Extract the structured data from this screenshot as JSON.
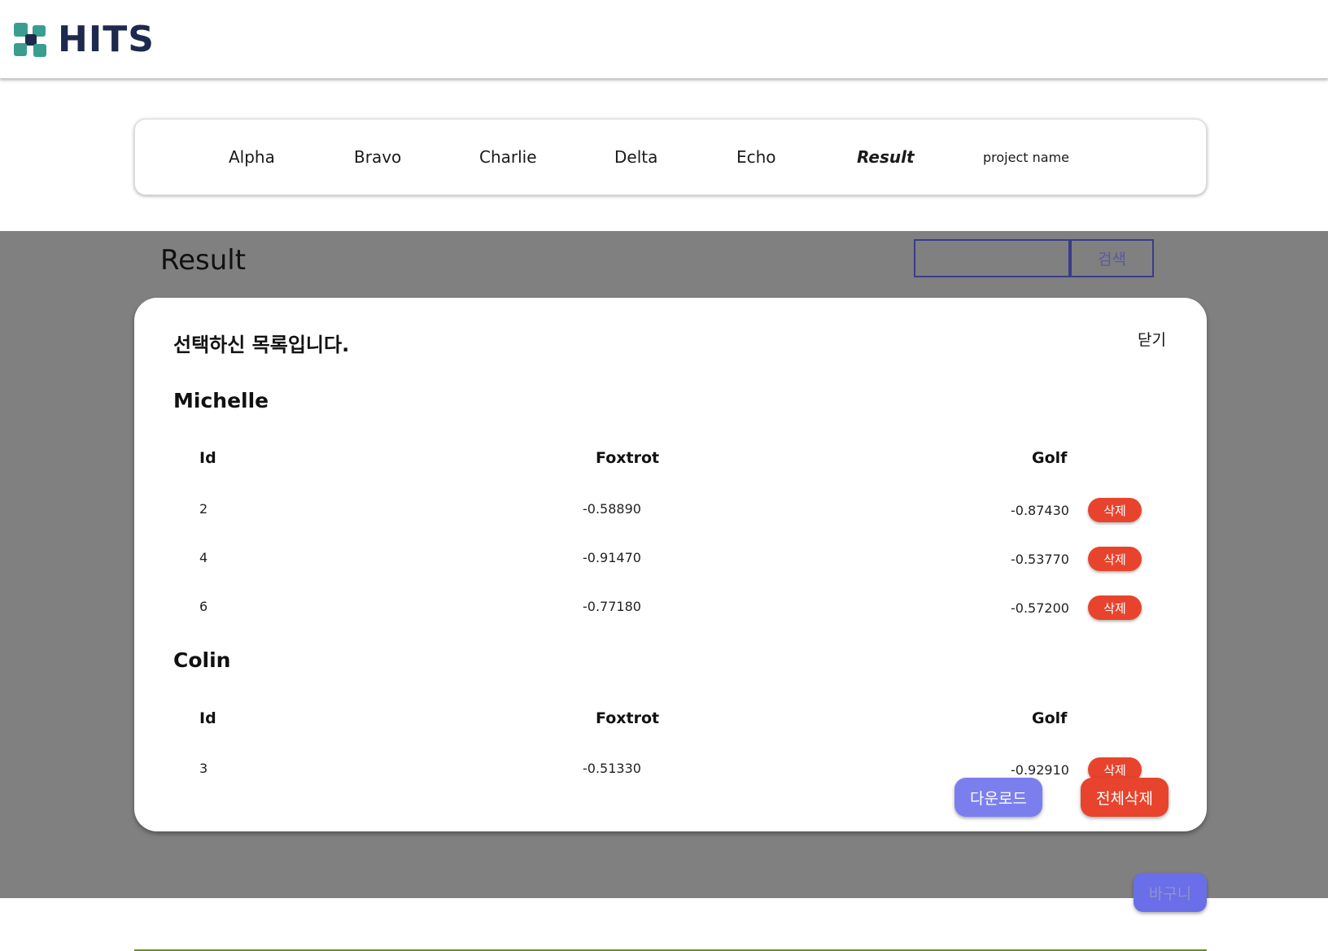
{
  "header": {
    "logo_text": "HITS",
    "logo_icon": "hits-logo-icon"
  },
  "nav": {
    "items": [
      {
        "label": "Alpha"
      },
      {
        "label": "Bravo"
      },
      {
        "label": "Charlie"
      },
      {
        "label": "Delta"
      },
      {
        "label": "Echo"
      },
      {
        "label": "Result"
      },
      {
        "label": "project name"
      }
    ],
    "active": "Result"
  },
  "page": {
    "title": "Result"
  },
  "search": {
    "value": "",
    "button_label": "검색"
  },
  "modal": {
    "title": "선택하신 목록입니다.",
    "close_label": "닫기",
    "groups": [
      {
        "name": "Michelle",
        "headers": [
          "Id",
          "Foxtrot",
          "Golf"
        ],
        "rows": [
          {
            "id": "2",
            "foxtrot": "-0.58890",
            "golf": "-0.87430",
            "delete_label": "삭제"
          },
          {
            "id": "4",
            "foxtrot": "-0.91470",
            "golf": "-0.53770",
            "delete_label": "삭제"
          },
          {
            "id": "6",
            "foxtrot": "-0.77180",
            "golf": "-0.57200",
            "delete_label": "삭제"
          }
        ]
      },
      {
        "name": "Colin",
        "headers": [
          "Id",
          "Foxtrot",
          "Golf"
        ],
        "rows": [
          {
            "id": "3",
            "foxtrot": "-0.51330",
            "golf": "-0.92910",
            "delete_label": "삭제"
          }
        ]
      }
    ],
    "download_label": "다운로드",
    "delete_all_label": "전체삭제"
  },
  "basket": {
    "label": "바구니"
  },
  "colors": {
    "accent_red": "#e8442d",
    "accent_purple": "#7b7fee",
    "overlay_gray": "#808080",
    "logo_navy": "#1d2a4d",
    "logo_teal": "#3a9e8f"
  }
}
